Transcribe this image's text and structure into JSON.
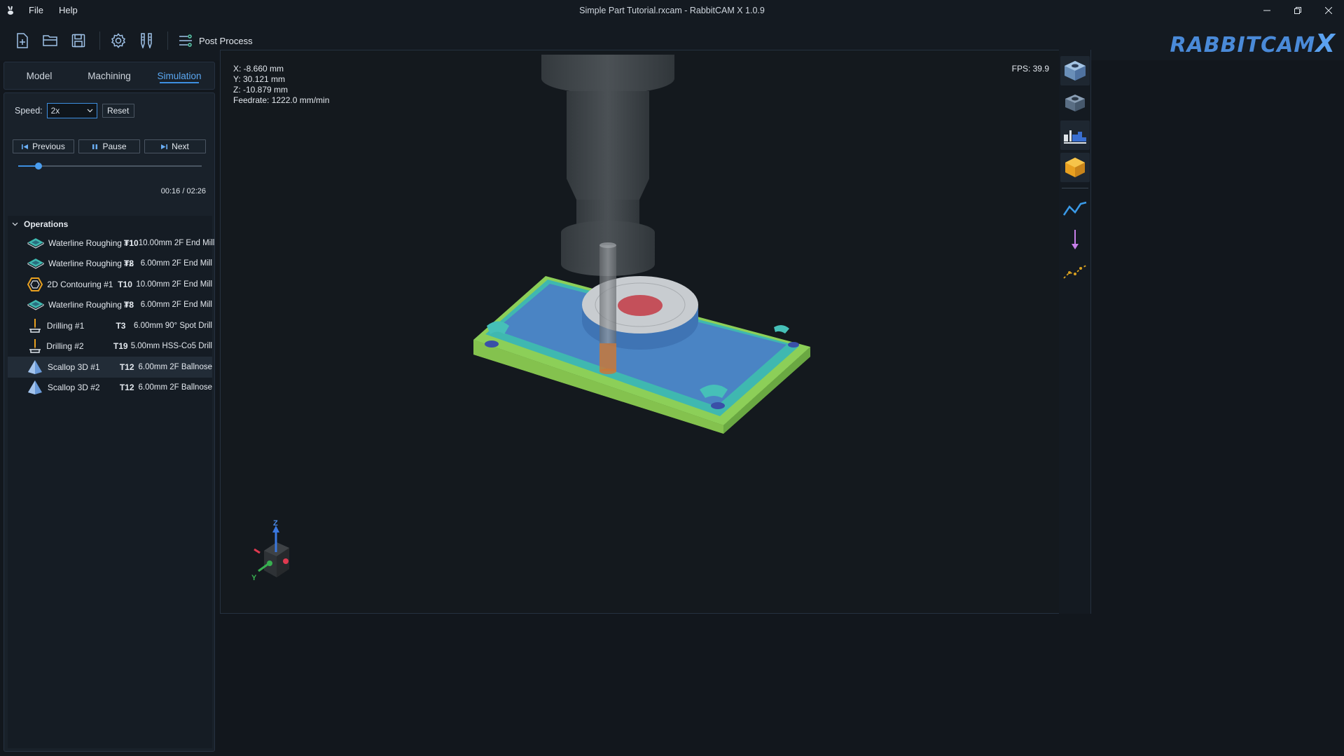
{
  "titlebar": {
    "app_icon": "rabbit-icon",
    "menu": [
      "File",
      "Help"
    ],
    "title": "Simple Part Tutorial.rxcam - RabbitCAM X 1.0.9",
    "controls": [
      "minimize-icon",
      "restore-icon",
      "close-icon"
    ]
  },
  "toolbar": {
    "buttons": [
      "new-file-icon",
      "open-folder-icon",
      "save-icon",
      "settings-icon",
      "tool-library-icon"
    ],
    "post_process_label": "Post Process"
  },
  "logo": {
    "text": "RABBITCAM",
    "suffix": "X"
  },
  "tabs": [
    {
      "label": "Model",
      "active": false
    },
    {
      "label": "Machining",
      "active": false
    },
    {
      "label": "Simulation",
      "active": true
    }
  ],
  "simulation": {
    "speed_label": "Speed:",
    "speed_value": "2x",
    "reset_label": "Reset",
    "previous_label": "Previous",
    "pause_label": "Pause",
    "next_label": "Next",
    "progress_fraction": 0.11,
    "time_text": "00:16 / 02:26"
  },
  "operations": {
    "header": "Operations",
    "items": [
      {
        "name": "Waterline Roughing #1",
        "tool": "T10",
        "desc": "10.00mm 2F End Mill",
        "icon": "waterline-icon",
        "selected": false
      },
      {
        "name": "Waterline Roughing #2",
        "tool": "T8",
        "desc": "6.00mm 2F End Mill",
        "icon": "waterline-icon",
        "selected": false
      },
      {
        "name": "2D Contouring #1",
        "tool": "T10",
        "desc": "10.00mm 2F End Mill",
        "icon": "contour-icon",
        "selected": false
      },
      {
        "name": "Waterline Roughing #3",
        "tool": "T8",
        "desc": "6.00mm 2F End Mill",
        "icon": "waterline-icon",
        "selected": false
      },
      {
        "name": "Drilling #1",
        "tool": "T3",
        "desc": "6.00mm 90° Spot Drill",
        "icon": "drill-icon",
        "selected": false
      },
      {
        "name": "Drilling #2",
        "tool": "T19",
        "desc": "5.00mm HSS-Co5 Drill",
        "icon": "drill-icon",
        "selected": false
      },
      {
        "name": "Scallop 3D #1",
        "tool": "T12",
        "desc": "6.00mm 2F Ballnose",
        "icon": "scallop-icon",
        "selected": true
      },
      {
        "name": "Scallop 3D #2",
        "tool": "T12",
        "desc": "6.00mm 2F Ballnose",
        "icon": "scallop-icon",
        "selected": false
      }
    ]
  },
  "viewport": {
    "x": "X: -8.660 mm",
    "y": "Y: 30.121 mm",
    "z": "Z: -10.879 mm",
    "feedrate": "Feedrate: 1222.0 mm/min",
    "fps": "FPS: 39.9",
    "axis_labels": {
      "z": "Z",
      "y": "Y"
    }
  },
  "right_panel": [
    "show-part-icon",
    "show-stock-icon",
    "show-tool-icon",
    "show-solid-icon",
    "toolpath-icon",
    "rapid-move-icon",
    "points-icon"
  ],
  "colors": {
    "accent": "#3d8fe0",
    "part_top": "#4a84c4",
    "part_side": "#7ab84a",
    "wall": "#3fb8b0",
    "hole": "#c4505a",
    "tool_tip": "#c8783a"
  }
}
